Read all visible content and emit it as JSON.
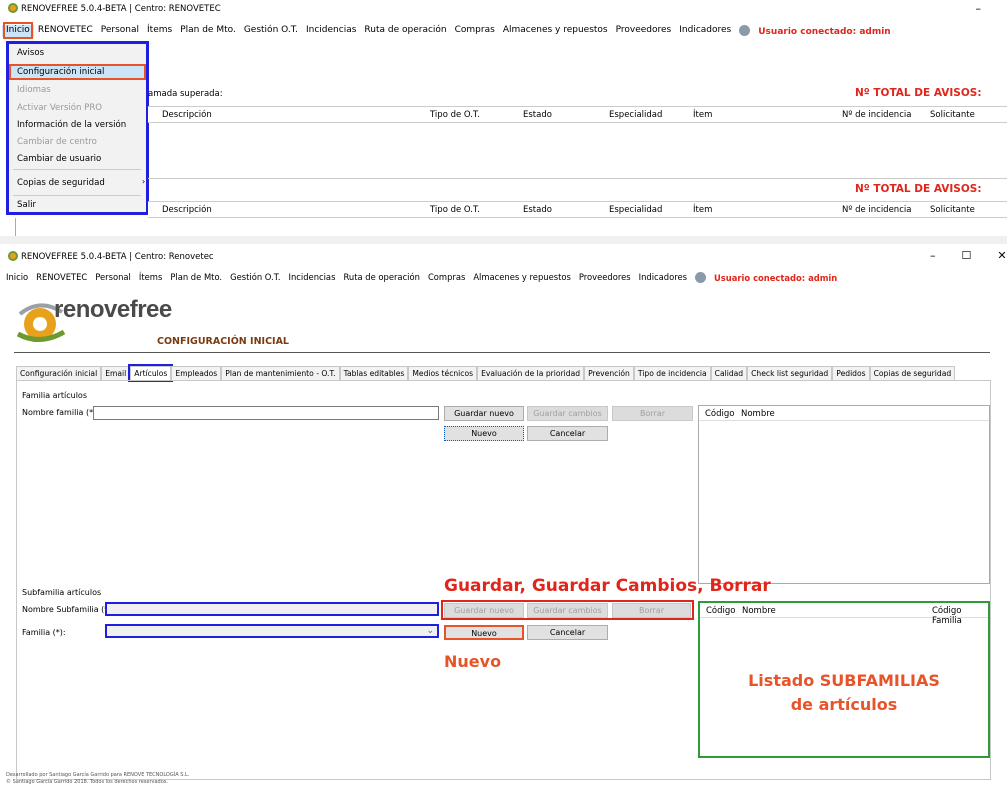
{
  "top": {
    "window_title": "RENOVEFREE 5.0.4-BETA | Centro: RENOVETEC",
    "menu": [
      "Inicio",
      "RENOVETEC",
      "Personal",
      "Ítems",
      "Plan de Mto.",
      "Gestión O.T.",
      "Incidencias",
      "Ruta de operación",
      "Compras",
      "Almacenes y repuestos",
      "Proveedores",
      "Indicadores"
    ],
    "user": "Usuario conectado: admin",
    "minimize": "–",
    "dropdown": [
      "Avisos",
      "Configuración inicial",
      "Idiomas",
      "Activar Versión PRO",
      "Información de la versión",
      "Cambiar de centro",
      "Cambiar de usuario",
      "Copias de seguridad",
      "Salir"
    ],
    "section_label": "amada superada:",
    "total_label": "Nº TOTAL DE AVISOS:",
    "columns": [
      "Descripción",
      "Tipo de O.T.",
      "Estado",
      "Especialidad",
      "Ítem",
      "Nº de incidencia",
      "Solicitante"
    ]
  },
  "bottom": {
    "window_title": "RENOVEFREE 5.0.4-BETA | Centro: Renovetec",
    "window_controls": [
      "–",
      "☐",
      "✕"
    ],
    "menu": [
      "Inicio",
      "RENOVETEC",
      "Personal",
      "Ítems",
      "Plan de Mto.",
      "Gestión O.T.",
      "Incidencias",
      "Ruta de operación",
      "Compras",
      "Almacenes y repuestos",
      "Proveedores",
      "Indicadores"
    ],
    "user": "Usuario conectado: admin",
    "logo": "renovefree",
    "section_title": "CONFIGURACIÓN INICIAL",
    "tabs": [
      "Configuración inicial",
      "Email",
      "Artículos",
      "Empleados",
      "Plan de mantenimiento - O.T.",
      "Tablas editables",
      "Medios técnicos",
      "Evaluación de la prioridad",
      "Prevención",
      "Tipo de incidencia",
      "Calidad",
      "Check list seguridad",
      "Pedidos",
      "Copias de seguridad"
    ],
    "familia": {
      "group": "Familia artículos",
      "label": "Nombre familia (*)",
      "btn_guardar_nuevo": "Guardar nuevo",
      "btn_guardar_cambios": "Guardar cambios",
      "btn_borrar": "Borrar",
      "btn_nuevo": "Nuevo",
      "btn_cancelar": "Cancelar",
      "list_cols": [
        "Código",
        "Nombre"
      ]
    },
    "subfamilia": {
      "group": "Subfamilia artículos",
      "label_nombre": "Nombre Subfamilia (*)",
      "label_familia": "Familia (*):",
      "btn_guardar_nuevo": "Guardar nuevo",
      "btn_guardar_cambios": "Guardar cambios",
      "btn_borrar": "Borrar",
      "btn_nuevo": "Nuevo",
      "btn_cancelar": "Cancelar",
      "list_cols": [
        "Código",
        "Nombre",
        "Código Familia"
      ]
    },
    "annotation_buttons": "Guardar, Guardar Cambios, Borrar",
    "annotation_nuevo": "Nuevo",
    "annotation_list_1": "Listado SUBFAMILIAS",
    "annotation_list_2": "de artículos",
    "footer_1": "Desarrollado por Santiago García Garrido para RENOVE TECNOLOGÍA S.L.",
    "footer_2": "© Santiago García Garrido 2018. Todos los derechos reservados."
  }
}
